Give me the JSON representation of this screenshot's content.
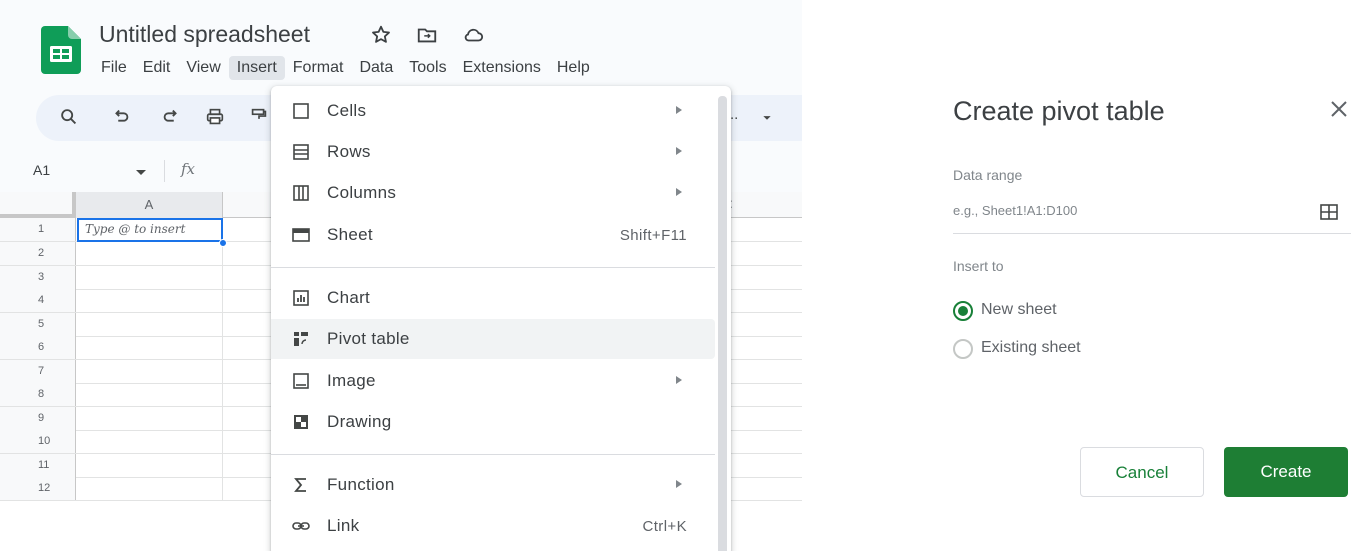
{
  "sheets": {
    "doc_title": "Untitled spreadsheet",
    "menu": [
      "File",
      "Edit",
      "View",
      "Insert",
      "Format",
      "Data",
      "Tools",
      "Extensions",
      "Help"
    ],
    "active_menu": "Insert",
    "toolbar_partial_text": "..",
    "name_box": "A1",
    "formula_fx": "fx",
    "column_header": "A",
    "rows": [
      "1",
      "2",
      "3",
      "4",
      "5",
      "6",
      "7",
      "8",
      "9",
      "10",
      "11",
      "12"
    ],
    "cell_a1_placeholder": "Type @ to insert",
    "colors": {
      "brand": "#0f9d58",
      "selection": "#1a73e8"
    }
  },
  "insert_menu": {
    "items": [
      {
        "label": "Cells",
        "icon": "cells-icon",
        "has_submenu": true
      },
      {
        "label": "Rows",
        "icon": "rows-icon",
        "has_submenu": true
      },
      {
        "label": "Columns",
        "icon": "columns-icon",
        "has_submenu": true
      },
      {
        "label": "Sheet",
        "icon": "sheet-icon",
        "shortcut": "Shift+F11"
      },
      {
        "label": "Chart",
        "icon": "chart-icon"
      },
      {
        "label": "Pivot table",
        "icon": "pivot-table-icon",
        "hovered": true
      },
      {
        "label": "Image",
        "icon": "image-icon",
        "has_submenu": true
      },
      {
        "label": "Drawing",
        "icon": "drawing-icon"
      },
      {
        "label": "Function",
        "icon": "function-sigma-icon",
        "has_submenu": true
      },
      {
        "label": "Link",
        "icon": "link-icon",
        "shortcut": "Ctrl+K"
      }
    ]
  },
  "pivot_dialog": {
    "title": "Create pivot table",
    "data_range_label": "Data range",
    "data_range_placeholder": "e.g., Sheet1!A1:D100",
    "insert_to_label": "Insert to",
    "options": [
      {
        "label": "New sheet",
        "checked": true
      },
      {
        "label": "Existing sheet",
        "checked": false
      }
    ],
    "cancel_label": "Cancel",
    "create_label": "Create",
    "colors": {
      "primary": "#1e7e34"
    }
  }
}
